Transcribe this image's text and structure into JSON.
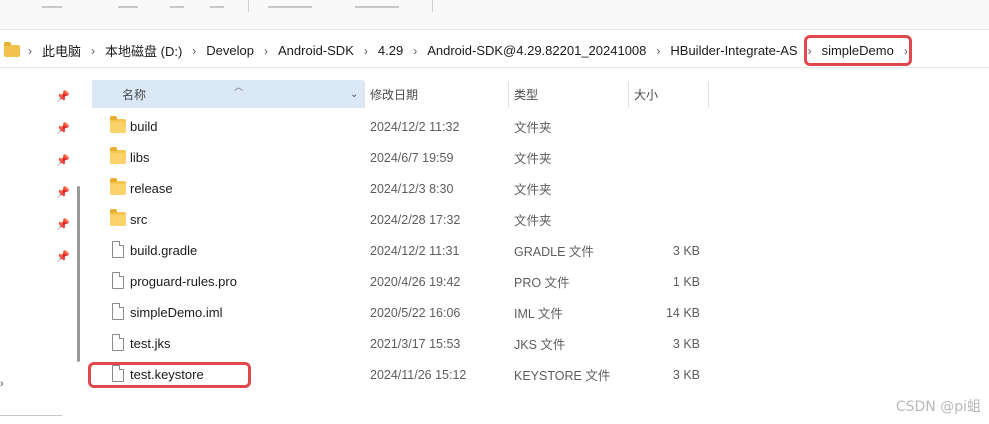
{
  "breadcrumb": {
    "items": [
      {
        "label": "此电脑"
      },
      {
        "label": "本地磁盘 (D:)"
      },
      {
        "label": "Develop"
      },
      {
        "label": "Android-SDK"
      },
      {
        "label": "4.29"
      },
      {
        "label": "Android-SDK@4.29.82201_20241008"
      },
      {
        "label": "HBuilder-Integrate-AS"
      },
      {
        "label": "simpleDemo"
      }
    ]
  },
  "columns": {
    "name": "名称",
    "date": "修改日期",
    "type": "类型",
    "size": "大小"
  },
  "files": [
    {
      "name": "build",
      "date": "2024/12/2 11:32",
      "type": "文件夹",
      "size": "",
      "icon": "folder-icon"
    },
    {
      "name": "libs",
      "date": "2024/6/7 19:59",
      "type": "文件夹",
      "size": "",
      "icon": "folder-icon"
    },
    {
      "name": "release",
      "date": "2024/12/3 8:30",
      "type": "文件夹",
      "size": "",
      "icon": "folder-icon"
    },
    {
      "name": "src",
      "date": "2024/2/28 17:32",
      "type": "文件夹",
      "size": "",
      "icon": "folder-icon"
    },
    {
      "name": "build.gradle",
      "date": "2024/12/2 11:31",
      "type": "GRADLE 文件",
      "size": "3 KB",
      "icon": "file-icon"
    },
    {
      "name": "proguard-rules.pro",
      "date": "2020/4/26 19:42",
      "type": "PRO 文件",
      "size": "1 KB",
      "icon": "file-icon"
    },
    {
      "name": "simpleDemo.iml",
      "date": "2020/5/22 16:06",
      "type": "IML 文件",
      "size": "14 KB",
      "icon": "file-icon"
    },
    {
      "name": "test.jks",
      "date": "2021/3/17 15:53",
      "type": "JKS 文件",
      "size": "3 KB",
      "icon": "file-icon"
    },
    {
      "name": "test.keystore",
      "date": "2024/11/26 15:12",
      "type": "KEYSTORE 文件",
      "size": "3 KB",
      "icon": "file-icon"
    }
  ],
  "watermark": "CSDN @pi蛆",
  "colors": {
    "highlight": "#e0484d",
    "header_selected": "#dbe9f7",
    "folder": "#f5c651"
  }
}
